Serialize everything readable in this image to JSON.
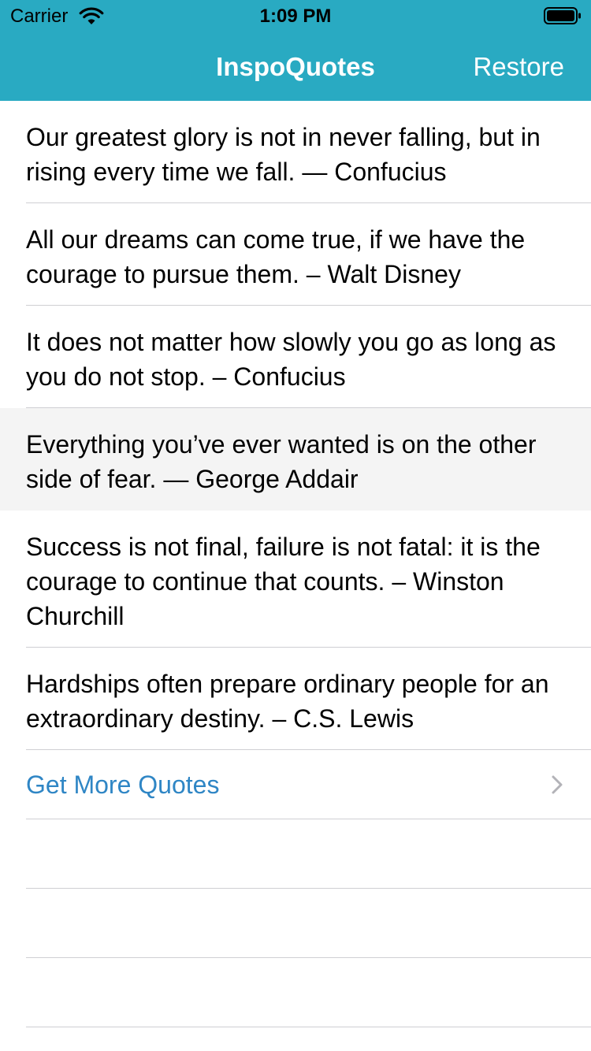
{
  "status_bar": {
    "carrier": "Carrier",
    "time": "1:09 PM",
    "wifi_icon": "wifi-icon",
    "battery_icon": "battery-full-icon"
  },
  "nav": {
    "title": "InspoQuotes",
    "restore_label": "Restore"
  },
  "quotes": [
    {
      "text": "Our greatest glory is not in never falling, but in rising every time we fall. — Confucius",
      "highlighted": false
    },
    {
      "text": "All our dreams can come true, if we have the courage to pursue them. – Walt Disney",
      "highlighted": false
    },
    {
      "text": "It does not matter how slowly you go as long as you do not stop. – Confucius",
      "highlighted": false
    },
    {
      "text": "Everything you’ve ever wanted is on the other side of fear. — George Addair",
      "highlighted": true
    },
    {
      "text": "Success is not final, failure is not fatal: it is the courage to continue that counts. – Winston Churchill",
      "highlighted": false
    },
    {
      "text": "Hardships often prepare ordinary people for an extraordinary destiny. – C.S. Lewis",
      "highlighted": false
    }
  ],
  "more_row": {
    "label": "Get More Quotes",
    "chevron_icon": "chevron-right-icon"
  },
  "colors": {
    "nav_background": "#29aac2",
    "link_blue": "#2f86c5",
    "highlight_row": "#f4f4f4",
    "separator": "#cfcfd3"
  }
}
